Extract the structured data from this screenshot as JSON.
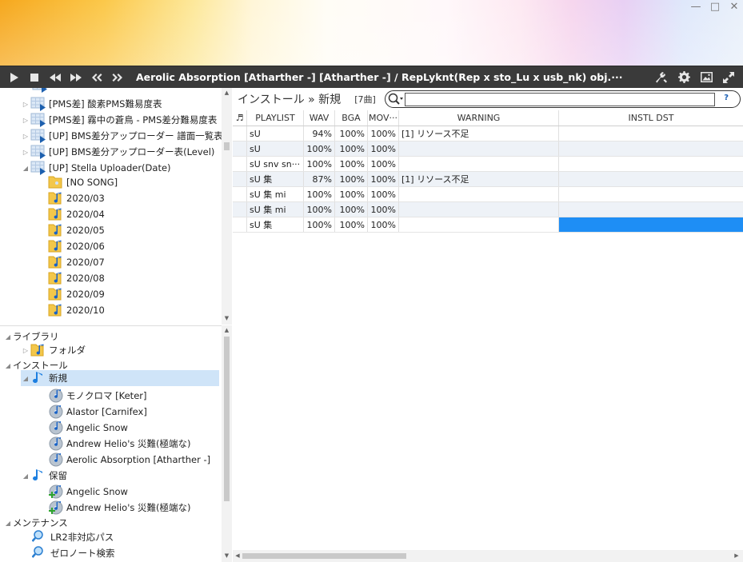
{
  "window": {
    "minimize": "—",
    "maximize": "□",
    "close": "✕"
  },
  "toolbar": {
    "now_playing": "Aerolic Absorption [Atharther -] [Atharther -] / RepLyknt(Rep x sto_Lu x usb_nk) obj.···"
  },
  "tree_top": [
    {
      "label": "[PMS差] 酸素PMS難易度表"
    },
    {
      "label": "[PMS差] 霧中の蒼鳥 - PMS差分難易度表"
    },
    {
      "label": "[UP] BMS差分アップローダー 譜面一覧表(Da"
    },
    {
      "label": "[UP] BMS差分アップローダー表(Level)"
    },
    {
      "label": "[UP] Stella Uploader(Date)"
    },
    {
      "label": "[NO SONG]"
    },
    {
      "label": "2020/03"
    },
    {
      "label": "2020/04"
    },
    {
      "label": "2020/05"
    },
    {
      "label": "2020/06"
    },
    {
      "label": "2020/07"
    },
    {
      "label": "2020/08"
    },
    {
      "label": "2020/09"
    },
    {
      "label": "2020/10"
    }
  ],
  "tree_bottom": {
    "library": "ライブラリ",
    "folder": "フォルダ",
    "install": "インストール",
    "new": "新規",
    "new_items": [
      "モノクロマ [Keter]",
      "Alastor [Carnifex]",
      "Angelic Snow",
      "Andrew Helio's 災難(極端な)",
      "Aerolic Absorption [Atharther -]"
    ],
    "hold": "保留",
    "hold_items": [
      "Angelic Snow",
      "Andrew Helio's 災難(極端な)"
    ],
    "maintenance": "メンテナンス",
    "maint_items": [
      "LR2非対応パス",
      "ゼロノート検索"
    ]
  },
  "right": {
    "breadcrumb": "インストール » 新規",
    "count": "[7曲]",
    "search_value": "",
    "search_help": "?"
  },
  "grid": {
    "headers": [
      "♬",
      "PLAYLIST",
      "WAV",
      "BGA",
      "MOV···",
      "WARNING",
      "INSTL DST"
    ],
    "rows": [
      {
        "playlist": "sU",
        "wav": "94%",
        "bga": "100%",
        "mov": "100%",
        "warning": "[1] リソース不足",
        "dst": ""
      },
      {
        "playlist": "sU",
        "wav": "100%",
        "bga": "100%",
        "mov": "100%",
        "warning": "",
        "dst": ""
      },
      {
        "playlist": "sU snv sn···",
        "wav": "100%",
        "bga": "100%",
        "mov": "100%",
        "warning": "",
        "dst": ""
      },
      {
        "playlist": "sU 集",
        "wav": "87%",
        "bga": "100%",
        "mov": "100%",
        "warning": "[1] リソース不足",
        "dst": ""
      },
      {
        "playlist": "sU 集 mi",
        "wav": "100%",
        "bga": "100%",
        "mov": "100%",
        "warning": "",
        "dst": ""
      },
      {
        "playlist": "sU 集 mi",
        "wav": "100%",
        "bga": "100%",
        "mov": "100%",
        "warning": "",
        "dst": ""
      },
      {
        "playlist": "sU 集",
        "wav": "100%",
        "bga": "100%",
        "mov": "100%",
        "warning": "",
        "dst": ""
      }
    ]
  },
  "colors": {
    "toolbar": "#3a3a3a",
    "selection": "#cfe4f8",
    "accent": "#1e8ef5"
  },
  "icons": [
    "play-icon",
    "stop-icon",
    "rewind-icon",
    "fast-forward-icon",
    "skip-back-icon",
    "skip-forward-icon",
    "wrench-icon",
    "gear-icon",
    "image-icon",
    "expand-icon",
    "search-icon",
    "folder-icon",
    "music-note-icon",
    "table-icon"
  ]
}
